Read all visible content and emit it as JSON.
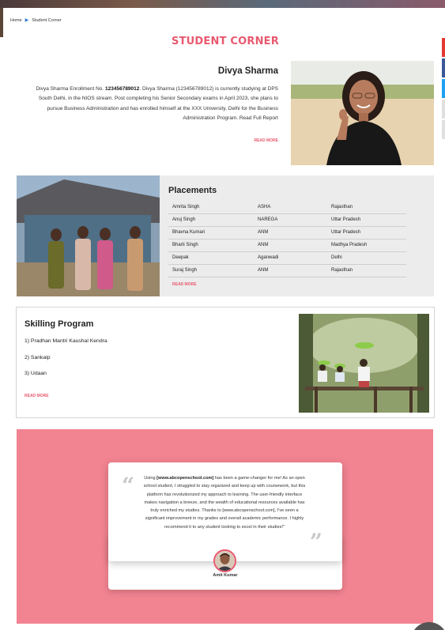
{
  "breadcrumb": {
    "home": "Home",
    "current": "Student Corner"
  },
  "page_title": "STUDENT CORNER",
  "profile": {
    "name": "Divya Sharma",
    "text_prefix": "Divya Sharma Enrollment No. ",
    "enrollment_no": "123456789012",
    "text_body": ". Divya Sharma (123456789012) is currently studying at DPS  South Delhi, in the NIOS stream. Post completing his Senior Secondary exams in April 2023, she plans to pursue Business Administration and has enrolled himself at the XXX University, Delhi for the Business Administration Program. Read Full Report",
    "read_more": "READ MORE"
  },
  "placements": {
    "title": "Placements",
    "rows": [
      [
        "Amrita Singh",
        "ASHA",
        "Rajasthan"
      ],
      [
        "Anuj Singh",
        "NAREGA",
        "Uttar Pradesh"
      ],
      [
        "Bhavna Kumari",
        "ANM",
        "Uttar Pradesh"
      ],
      [
        "Bharti Singh",
        "ANM",
        "Madhya Pradesh"
      ],
      [
        "Deepak",
        "Aganwadi",
        "Delhi"
      ],
      [
        "Suraj Singh",
        "ANM",
        "Rajasthan"
      ]
    ],
    "read_more": "READ MORE"
  },
  "skilling": {
    "title": "Skilling Program",
    "items": [
      "1) Pradhan Mantri Kaushal Kendra",
      "2) Sankalp",
      "3) Udaan"
    ],
    "read_more": "READ MORE"
  },
  "testimonial": {
    "text_prefix": "Using ",
    "site_bold": "[www.abcopenschool.com]",
    "text_body": " has been a game-changer for me! As an open school student, I struggled to stay organized and keep up with coursework, but this platform has revolutionized my approach to learning. The user-friendly interface makes navigation a breeze, and the wealth of educational resources available has truly enriched my studies. Thanks to [www.abcopenschool.com], I've seen a significant improvement in my grades and overall academic performance. I highly recommend it to any student looking to excel in their studies!\"",
    "author": "Amit Kumar"
  },
  "colors": {
    "accent": "#e8596f",
    "testimonial_bg": "#f28391",
    "placements_bg": "#ececec",
    "breadcrumb_sep": "#2a7ad5",
    "social": [
      "#e53935",
      "#3b5998",
      "#1da1f2",
      "#e0e0e0",
      "#e0e0e0"
    ]
  },
  "icons": {
    "breadcrumb_separator": "triangle-right-icon",
    "quote_open": "quote-open-icon",
    "quote_close": "quote-close-icon"
  }
}
